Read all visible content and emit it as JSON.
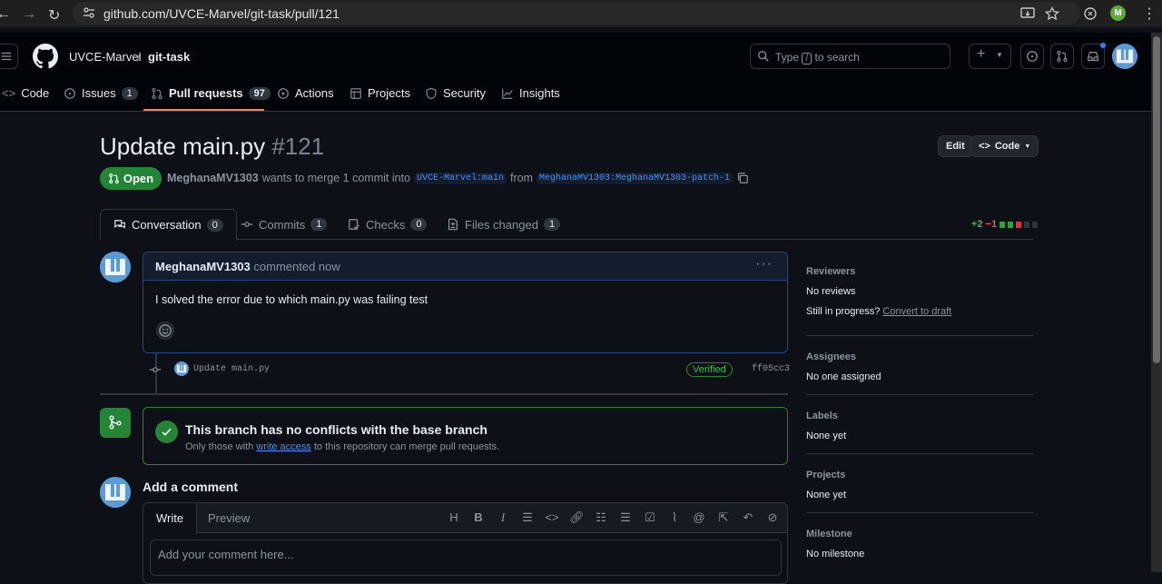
{
  "browser": {
    "url": "github.com/UVCE-Marvel/git-task/pull/121",
    "profile_initial": "M"
  },
  "header": {
    "owner": "UVCE-Marvel",
    "separator": "/",
    "repo": "git-task",
    "search_placeholder_prefix": "Type",
    "search_key": "/",
    "search_placeholder_suffix": "to search"
  },
  "repo_tabs": [
    {
      "label": "Code",
      "icon": "code-icon"
    },
    {
      "label": "Issues",
      "count": "1",
      "icon": "issue-icon"
    },
    {
      "label": "Pull requests",
      "count": "97",
      "icon": "pull-request-icon",
      "selected": true
    },
    {
      "label": "Actions",
      "icon": "play-icon"
    },
    {
      "label": "Projects",
      "icon": "table-icon"
    },
    {
      "label": "Security",
      "icon": "shield-icon"
    },
    {
      "label": "Insights",
      "icon": "graph-icon"
    }
  ],
  "pr": {
    "title": "Update main.py",
    "number": "#121",
    "edit_label": "Edit",
    "code_label": "Code",
    "state": "Open",
    "author": "MeghanaMV1303",
    "meta_text": "wants to merge 1 commit into",
    "base_branch": "UVCE-Marvel:main",
    "from_text": "from",
    "head_branch": "MeghanaMV1303:MeghanaMV1303-patch-1"
  },
  "pr_tabs": [
    {
      "label": "Conversation",
      "count": "0"
    },
    {
      "label": "Commits",
      "count": "1"
    },
    {
      "label": "Checks",
      "count": "0"
    },
    {
      "label": "Files changed",
      "count": "1"
    }
  ],
  "diffstat": {
    "added": "+2",
    "removed": "−1"
  },
  "comment": {
    "author": "MeghanaMV1303",
    "action": "commented now",
    "body": "I solved the error due to which main.py was failing test"
  },
  "commit": {
    "message": "Update main.py",
    "verified": "Verified",
    "sha": "ff05cc3"
  },
  "merge": {
    "title": "This branch has no conflicts with the base branch",
    "desc_prefix": "Only those with",
    "desc_link": "write access",
    "desc_suffix": "to this repository can merge pull requests."
  },
  "add_comment": {
    "title": "Add a comment",
    "write_tab": "Write",
    "preview_tab": "Preview",
    "placeholder": "Add your comment here..."
  },
  "sidebar": {
    "reviewers": {
      "heading": "Reviewers",
      "value": "No reviews",
      "progress_text": "Still in progress?",
      "progress_link": "Convert to draft"
    },
    "assignees": {
      "heading": "Assignees",
      "value": "No one assigned"
    },
    "labels": {
      "heading": "Labels",
      "value": "None yet"
    },
    "projects": {
      "heading": "Projects",
      "value": "None yet"
    },
    "milestone": {
      "heading": "Milestone",
      "value": "No milestone"
    }
  },
  "colors": {
    "background": "#0d1117",
    "accent_green": "#238636",
    "link_blue": "#4493f8",
    "tab_underline": "#f78166"
  }
}
